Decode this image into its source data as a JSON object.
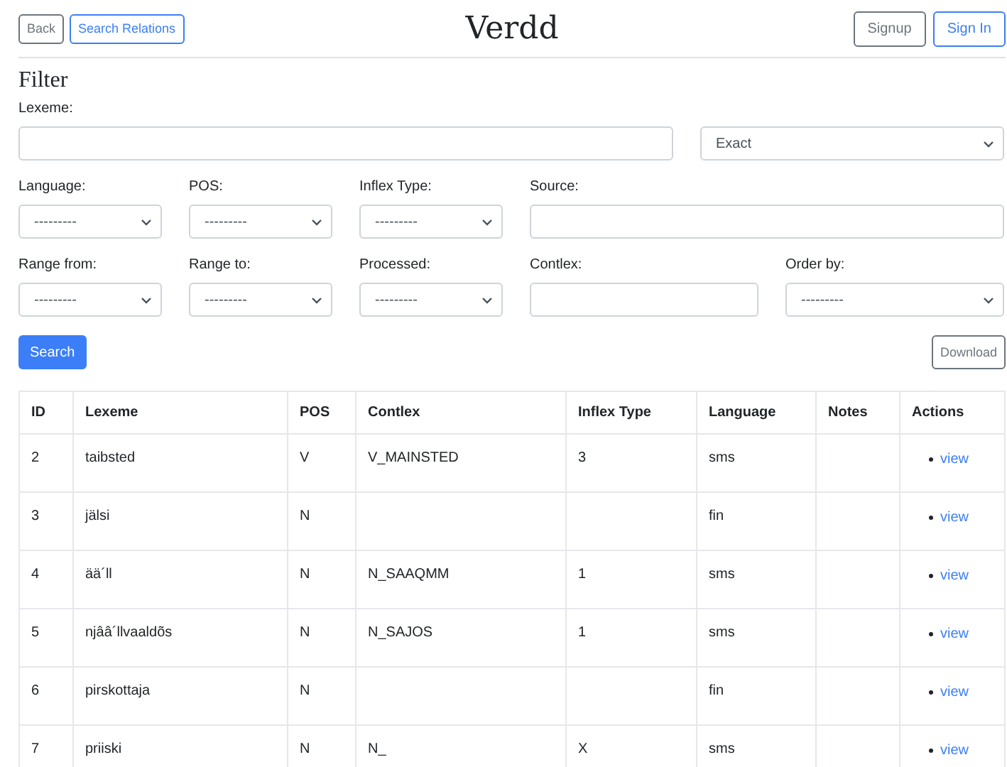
{
  "header": {
    "back_button": "Back",
    "relations_button": "Search Relations",
    "title": "Verdd",
    "signup_button": "Signup",
    "signin_button": "Sign In"
  },
  "filter": {
    "heading": "Filter",
    "lexeme_label": "Lexeme:",
    "match_select": "Exact",
    "row_1": [
      {
        "label": "Language:",
        "kind": "select",
        "value": "---------"
      },
      {
        "label": "POS:",
        "kind": "select",
        "value": "---------"
      },
      {
        "label": "Inflex Type:",
        "kind": "select",
        "value": "---------"
      },
      {
        "label": "Source:",
        "kind": "text"
      }
    ],
    "row_2": [
      {
        "label": "Range from:",
        "kind": "select",
        "value": "---------"
      },
      {
        "label": "Range to:",
        "kind": "select",
        "value": "---------"
      },
      {
        "label": "Processed:",
        "kind": "select",
        "value": "---------"
      },
      {
        "label": "Contlex:",
        "kind": "text"
      },
      {
        "label": "Order by:",
        "kind": "select",
        "value": "---------"
      }
    ],
    "search_button": "Search",
    "download_button": "Download"
  },
  "table": {
    "columns": [
      "ID",
      "Lexeme",
      "POS",
      "Contlex",
      "Inflex Type",
      "Language",
      "Notes",
      "Actions"
    ],
    "rows": [
      {
        "id": "2",
        "lexeme": "taibsted",
        "pos": "V",
        "contlex": "V_MAINSTED",
        "inflex_type": "3",
        "language": "sms",
        "notes": "",
        "action": "view"
      },
      {
        "id": "3",
        "lexeme": "jälsi",
        "pos": "N",
        "contlex": "",
        "inflex_type": "",
        "language": "fin",
        "notes": "",
        "action": "view"
      },
      {
        "id": "4",
        "lexeme": "ää´ll",
        "pos": "N",
        "contlex": "N_SAAQMM",
        "inflex_type": "1",
        "language": "sms",
        "notes": "",
        "action": "view"
      },
      {
        "id": "5",
        "lexeme": "njââ´llvaaldõs",
        "pos": "N",
        "contlex": "N_SAJOS",
        "inflex_type": "1",
        "language": "sms",
        "notes": "",
        "action": "view"
      },
      {
        "id": "6",
        "lexeme": "pirskottaja",
        "pos": "N",
        "contlex": "",
        "inflex_type": "",
        "language": "fin",
        "notes": "",
        "action": "view"
      },
      {
        "id": "7",
        "lexeme": "priiski",
        "pos": "N",
        "contlex": "N_",
        "inflex_type": "X",
        "language": "sms",
        "notes": "",
        "action": "view"
      }
    ]
  }
}
